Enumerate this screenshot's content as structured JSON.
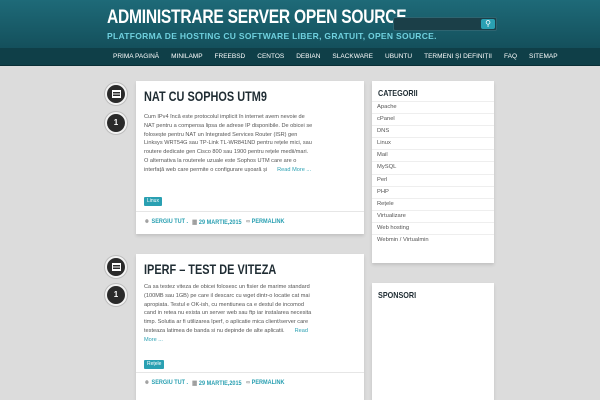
{
  "header": {
    "site_title": "ADMINISTRARE SERVER OPEN SOURCE",
    "tagline": "PLATFORMA DE HOSTING CU SOFTWARE LIBER, GRATUIT, OPEN SOURCE.",
    "search_placeholder": ""
  },
  "nav": {
    "items": [
      "Prima pagină",
      "MiniLAMP",
      "FreeBSD",
      "CentOS",
      "Debian",
      "Slackware",
      "Ubuntu",
      "Termeni și definiții",
      "FAQ",
      "Sitemap"
    ]
  },
  "posts": [
    {
      "title": "NAT CU SOPHOS UTM9",
      "comments": "1",
      "excerpt": "Cum IPv4 încă este protocolul implicit în internet avem nevoie de NAT pentru a compensa lipsa de adrese IP disponibile. De obicei se folosește pentru NAT un Integrated Services Router (ISR) gen Linksys WRT54G sau TP-Link TL-WR841ND pentru rețele mici, sau routere dedicate gen Cisco 800 sau 1900 pentru rețele medii/mari. O alternativa la routerele uzuale este Sophos UTM care are o interfață web care permite o configurare ușoară și",
      "read_more": "Read More ...",
      "tag": "Linux",
      "author": "SERGIU TUT .",
      "date": "29 MARTIE,2015",
      "permalink": "PERMALINK"
    },
    {
      "title": "IPERF – TEST DE VITEZA",
      "comments": "1",
      "excerpt": "Ca sa testez viteza de obicei folosesc un fisier de marime standard (100MB sau 1GB) pe care il descarc cu wget dintr-o locatie cat mai apropiata. Testul e OK-ish, cu mentiunea ca e destul de incomod cand in retea nu exista un server web sau ftp iar instalarea necesita timp. Solutia ar fi utilizarea Iperf, o aplicatie mica client/server care testeaza latimea de banda si nu depinde de alte aplicatii.",
      "read_more": "Read More ...",
      "tag": "Rețele",
      "author": "SERGIU TUT .",
      "date": "29 MARTIE,2015",
      "permalink": "PERMALINK"
    }
  ],
  "sidebar": {
    "categories_title": "CATEGORII",
    "categories": [
      "Apache",
      "cPanel",
      "DNS",
      "Linux",
      "Mail",
      "MySQL",
      "Perl",
      "PHP",
      "Rețele",
      "Virtualizare",
      "Web hosting",
      "Webmin / Virtualmin"
    ],
    "sponsors_title": "SPONSORI"
  },
  "icons": {
    "post_format": "document-icon",
    "search": "search-icon",
    "author": "user-icon",
    "date": "calendar-icon",
    "permalink": "link-icon"
  },
  "colors": {
    "header": "#1e6a78",
    "nav": "#0f3f48",
    "accent": "#2aa0b2",
    "background": "#dcdcdc"
  }
}
